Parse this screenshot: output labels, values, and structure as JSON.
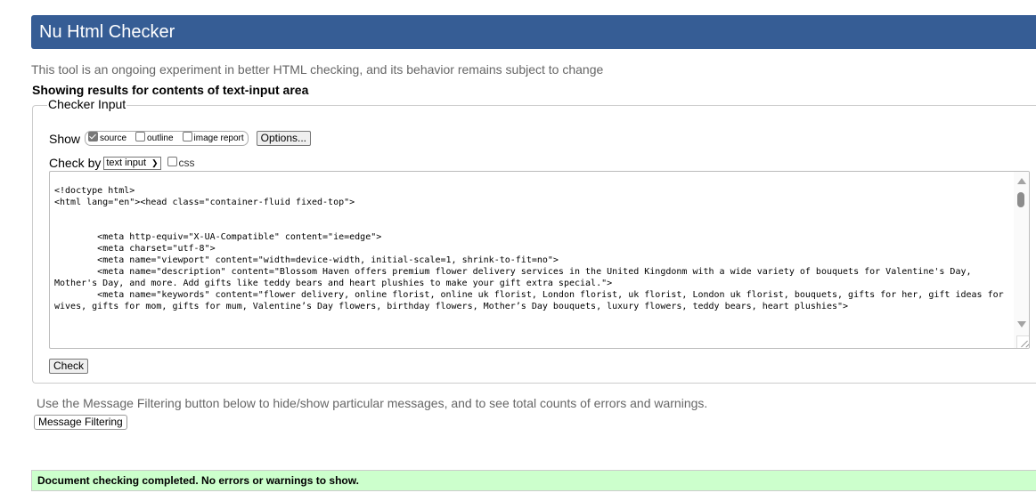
{
  "header": {
    "title": "Nu Html Checker"
  },
  "intro_text": "This tool is an ongoing experiment in better HTML checking, and its behavior remains subject to change",
  "showing_text": "Showing results for contents of text-input area",
  "checker_input": {
    "legend": "Checker Input",
    "show_label": "Show",
    "show_options": [
      {
        "label": "source",
        "checked": true
      },
      {
        "label": "outline",
        "checked": false
      },
      {
        "label": "image report",
        "checked": false
      }
    ],
    "options_button": "Options...",
    "check_by_label": "Check by",
    "check_by_selected": "text input",
    "css_label": "css",
    "css_checked": false,
    "source_text": "<!doctype html>\n<html lang=\"en\"><head class=\"container-fluid fixed-top\">\n\n\n        <meta http-equiv=\"X-UA-Compatible\" content=\"ie=edge\">\n        <meta charset=\"utf-8\">\n        <meta name=\"viewport\" content=\"width=device-width, initial-scale=1, shrink-to-fit=no\">\n        <meta name=\"description\" content=\"Blossom Haven offers premium flower delivery services in the United Kingdonm with a wide variety of bouquets for Valentine's Day,\nMother's Day, and more. Add gifts like teddy bears and heart plushies to make your gift extra special.\">\n        <meta name=\"keywords\" content=\"flower delivery, online florist, online uk florist, London florist, uk florist, London uk florist, bouquets, gifts for her, gift ideas for\nwives, gifts for mom, gifts for mum, Valentine’s Day flowers, birthday flowers, Mother’s Day bouquets, luxury flowers, teddy bears, heart plushies\">",
    "check_button": "Check"
  },
  "filter_text": "Use the Message Filtering button below to hide/show particular messages, and to see total counts of errors and warnings.",
  "filter_button": "Message Filtering",
  "result_message": "Document checking completed. No errors or warnings to show.",
  "colors": {
    "header_bg": "#365d95",
    "success_bg": "#ccffcc"
  }
}
